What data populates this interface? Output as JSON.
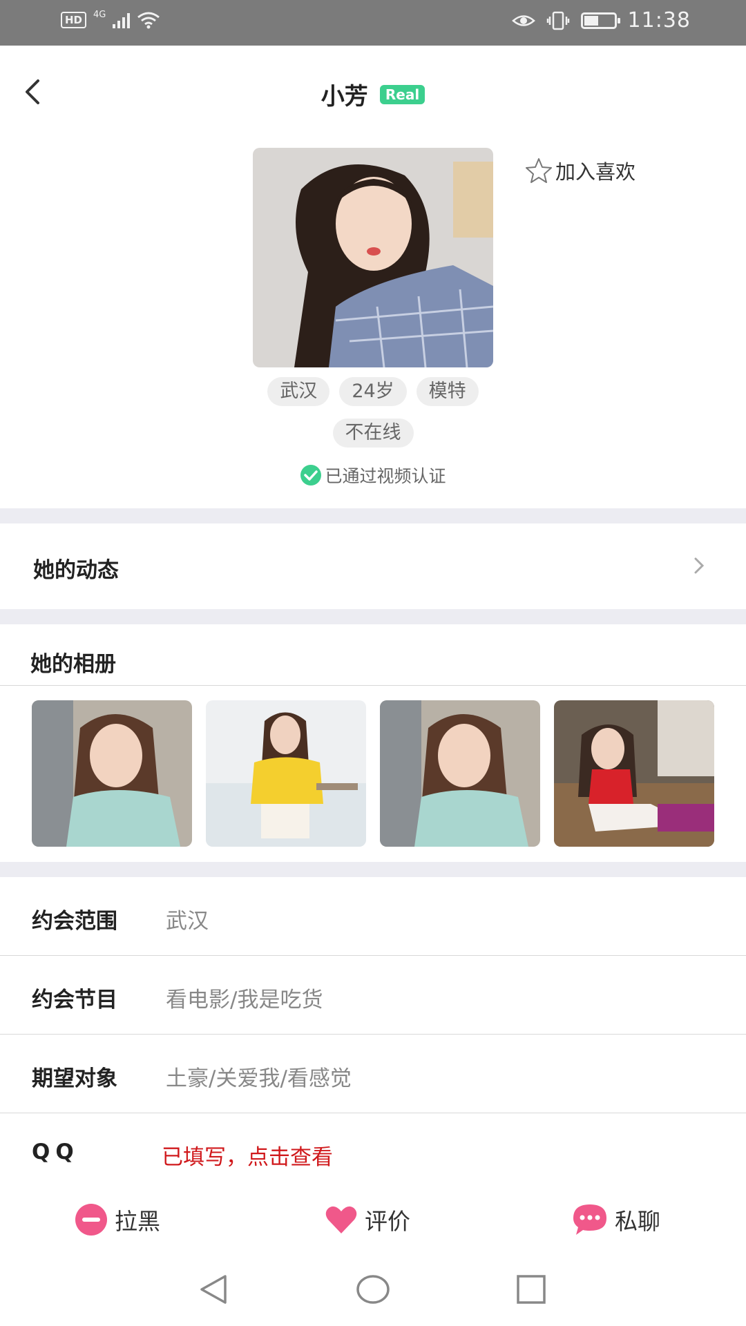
{
  "status_bar": {
    "hd": "HD",
    "network": "4G",
    "time": "11:38",
    "icons": [
      "signal-icon",
      "wifi-icon",
      "eye-icon",
      "vibrate-icon",
      "battery-icon"
    ]
  },
  "header": {
    "title": "小芳",
    "badge": "Real",
    "back_icon": "back-arrow-icon"
  },
  "profile": {
    "favorite_label": "加入喜欢",
    "tags": [
      "武汉",
      "24岁",
      "模特"
    ],
    "online_status": "不在线",
    "verification": "已通过视频认证"
  },
  "moments": {
    "title": "她的动态"
  },
  "album": {
    "title": "她的相册",
    "photo_count": 4
  },
  "info": {
    "range_label": "约会范围",
    "range_value": "武汉",
    "program_label": "约会节目",
    "program_value": "看电影/我是吃货",
    "expect_label": "期望对象",
    "expect_value": "土豪/关爱我/看感觉",
    "qq_label": "QQ",
    "qq_value": "已填写，点击查看"
  },
  "actions": {
    "block_label": "拉黑",
    "rate_label": "评价",
    "chat_label": "私聊"
  },
  "colors": {
    "accent_pink": "#f0588a",
    "verify_green": "#3ccf8e",
    "qq_red": "#d0191c",
    "status_bar_gray": "#7b7b7b"
  }
}
